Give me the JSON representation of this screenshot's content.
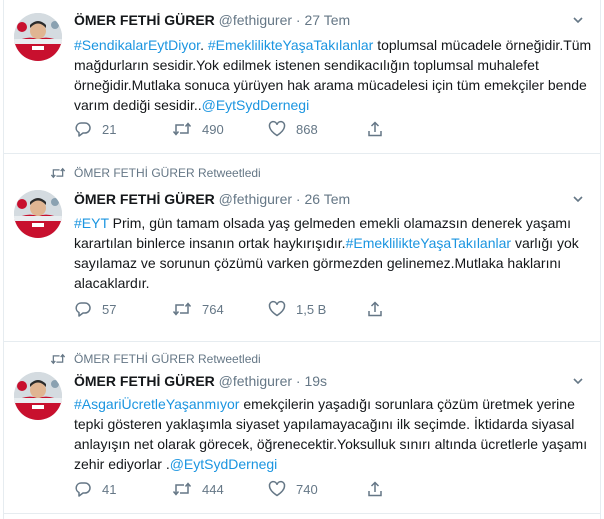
{
  "colors": {
    "link": "#1b95e0",
    "secondary": "#657786",
    "border": "#e6ecf0"
  },
  "tweets": [
    {
      "retweeted_by": "",
      "name": "ÖMER FETHİ GÜRER",
      "handle": "@fethigurer",
      "dot": "·",
      "time": "27 Tem",
      "text_parts": [
        {
          "text": "#SendikalarEytDiyor",
          "link": true
        },
        {
          "text": ". ",
          "link": false
        },
        {
          "text": "#EmeklilikteYaşaTakılanlar",
          "link": true
        },
        {
          "text": "  toplumsal mücadele örneğidir.Tüm mağdurların sesidir.Yok edilmek istenen sendikacılığın toplumsal muhalefet örneğidir.Mutlaka sonuca yürüyen hak arama mücadelesi için tüm emekçiler bende varım dediği sesidir..",
          "link": false
        },
        {
          "text": "@EytSydDernegi",
          "link": true
        }
      ],
      "replies": "21",
      "retweets": "490",
      "likes": "868"
    },
    {
      "retweeted_by": "ÖMER FETHİ GÜRER Retweetledi",
      "name": "ÖMER FETHİ GÜRER",
      "handle": "@fethigurer",
      "dot": "·",
      "time": "26 Tem",
      "text_parts": [
        {
          "text": "#EYT",
          "link": true
        },
        {
          "text": "  Prim, gün tamam  olsada yaş gelmeden emekli olamazsın denerek yaşamı karartılan binlerce insanın ortak haykırışıdır.",
          "link": false
        },
        {
          "text": "#EmeklilikteYaşaTakılanlar",
          "link": true
        },
        {
          "text": " varlığı yok sayılamaz ve sorunun çözümü varken görmezden gelinemez.Mutlaka haklarını alacaklardır.",
          "link": false
        }
      ],
      "replies": "57",
      "retweets": "764",
      "likes": "1,5 B"
    },
    {
      "retweeted_by": "ÖMER FETHİ GÜRER Retweetledi",
      "name": "ÖMER FETHİ GÜRER",
      "handle": "@fethigurer",
      "dot": "·",
      "time": "19s",
      "text_parts": [
        {
          "text": "#AsgariÜcretleYaşanmıyor",
          "link": true
        },
        {
          "text": "  emekçilerin yaşadığı sorunlara çözüm üretmek yerine tepki gösteren yaklaşımla siyaset yapılamayacağını ilk seçimde. İktidarda siyasal anlayışın net olarak görecek, öğrenecektir.Yoksulluk sınırı altında ücretlerle yaşamı zehir ediyorlar .",
          "link": false
        },
        {
          "text": "@EytSydDernegi",
          "link": true
        }
      ],
      "replies": "41",
      "retweets": "444",
      "likes": "740"
    }
  ]
}
